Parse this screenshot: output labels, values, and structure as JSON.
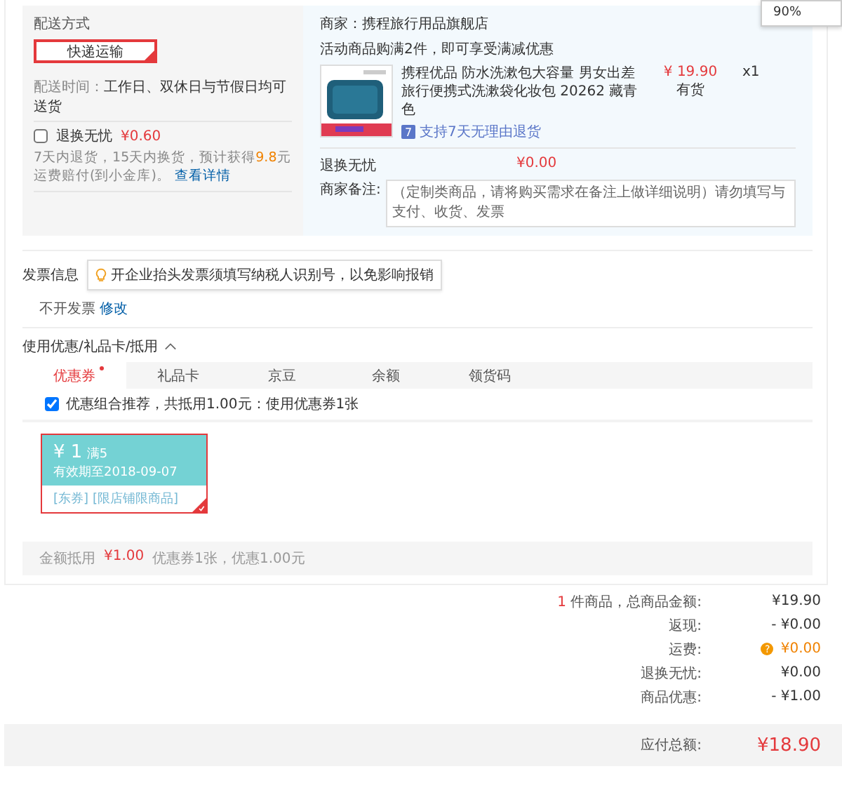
{
  "zoom_popup": {
    "value": "90%"
  },
  "delivery": {
    "title": "配送方式",
    "methods": [
      {
        "label": "快递运输",
        "selected": true
      }
    ],
    "time_label": "配送时间：",
    "time_value": "工作日、双休日与节假日均可送货",
    "insurance": {
      "label": "退换无忧",
      "price": "¥0.60",
      "checked": false,
      "desc_parts": [
        "7天内退货，15天内换货，预计获得",
        "9.8",
        "元运费赔付(到小金库)。"
      ],
      "link": "查看详情"
    }
  },
  "shop": {
    "merchant": "商家：携程旅行用品旗舰店",
    "promo": "活动商品购满2件，即可享受满减优惠",
    "product": {
      "title": "携程优品 防水洗漱包大容量 男女出差旅行便携式洗漱袋化妆包 20262 藏青色",
      "price": "¥ 19.90",
      "stock": "有货",
      "qty": "x1",
      "service_badge": "7",
      "service": "支持7天无理由退货"
    },
    "insurance": {
      "label": "退换无忧",
      "price": "¥0.00"
    },
    "note": {
      "label": "商家备注:",
      "placeholder": "（定制类商品，请将购买需求在备注上做详细说明）请勿填写与支付、收货、发票"
    }
  },
  "invoice": {
    "label": "发票信息",
    "tip": "开企业抬头发票须填写纳税人识别号，以免影响报销",
    "value": "不开发票",
    "edit": "修改"
  },
  "discounts": {
    "title": "使用优惠/礼品卡/抵用",
    "expanded": true,
    "tabs": [
      {
        "label": "优惠券",
        "selected": true,
        "badge": true
      },
      {
        "label": "礼品卡",
        "selected": false,
        "badge": false
      },
      {
        "label": "京豆",
        "selected": false,
        "badge": false
      },
      {
        "label": "余额",
        "selected": false,
        "badge": false
      },
      {
        "label": "领货码",
        "selected": false,
        "badge": false
      }
    ],
    "combo": {
      "checked": true,
      "label": "优惠组合推荐，共抵用1.00元：使用优惠券1张"
    },
    "coupons": [
      {
        "amount": "¥ 1",
        "condition": "满5",
        "validity": "有效期至2018-09-07",
        "tags": [
          "[东券]",
          "[限店铺限商品]"
        ],
        "selected": true
      }
    ],
    "summary": {
      "label": "金额抵用",
      "amount": "¥1.00",
      "detail": "优惠券1张，优惠1.00元"
    }
  },
  "totals": {
    "count": "1",
    "count_label": "件商品，总商品金额:",
    "count_value": "¥19.90",
    "rows": [
      {
        "kind": "plain",
        "label": "返现:",
        "value": "- ¥0.00"
      },
      {
        "kind": "fee",
        "label": "运费:",
        "help": "?",
        "value": "¥0.00"
      },
      {
        "kind": "plain",
        "label": "退换无忧:",
        "value": "¥0.00"
      },
      {
        "kind": "plain",
        "label": "商品优惠:",
        "value": "- ¥1.00"
      }
    ]
  },
  "payable": {
    "label": "应付总额:",
    "value": "¥18.90"
  }
}
